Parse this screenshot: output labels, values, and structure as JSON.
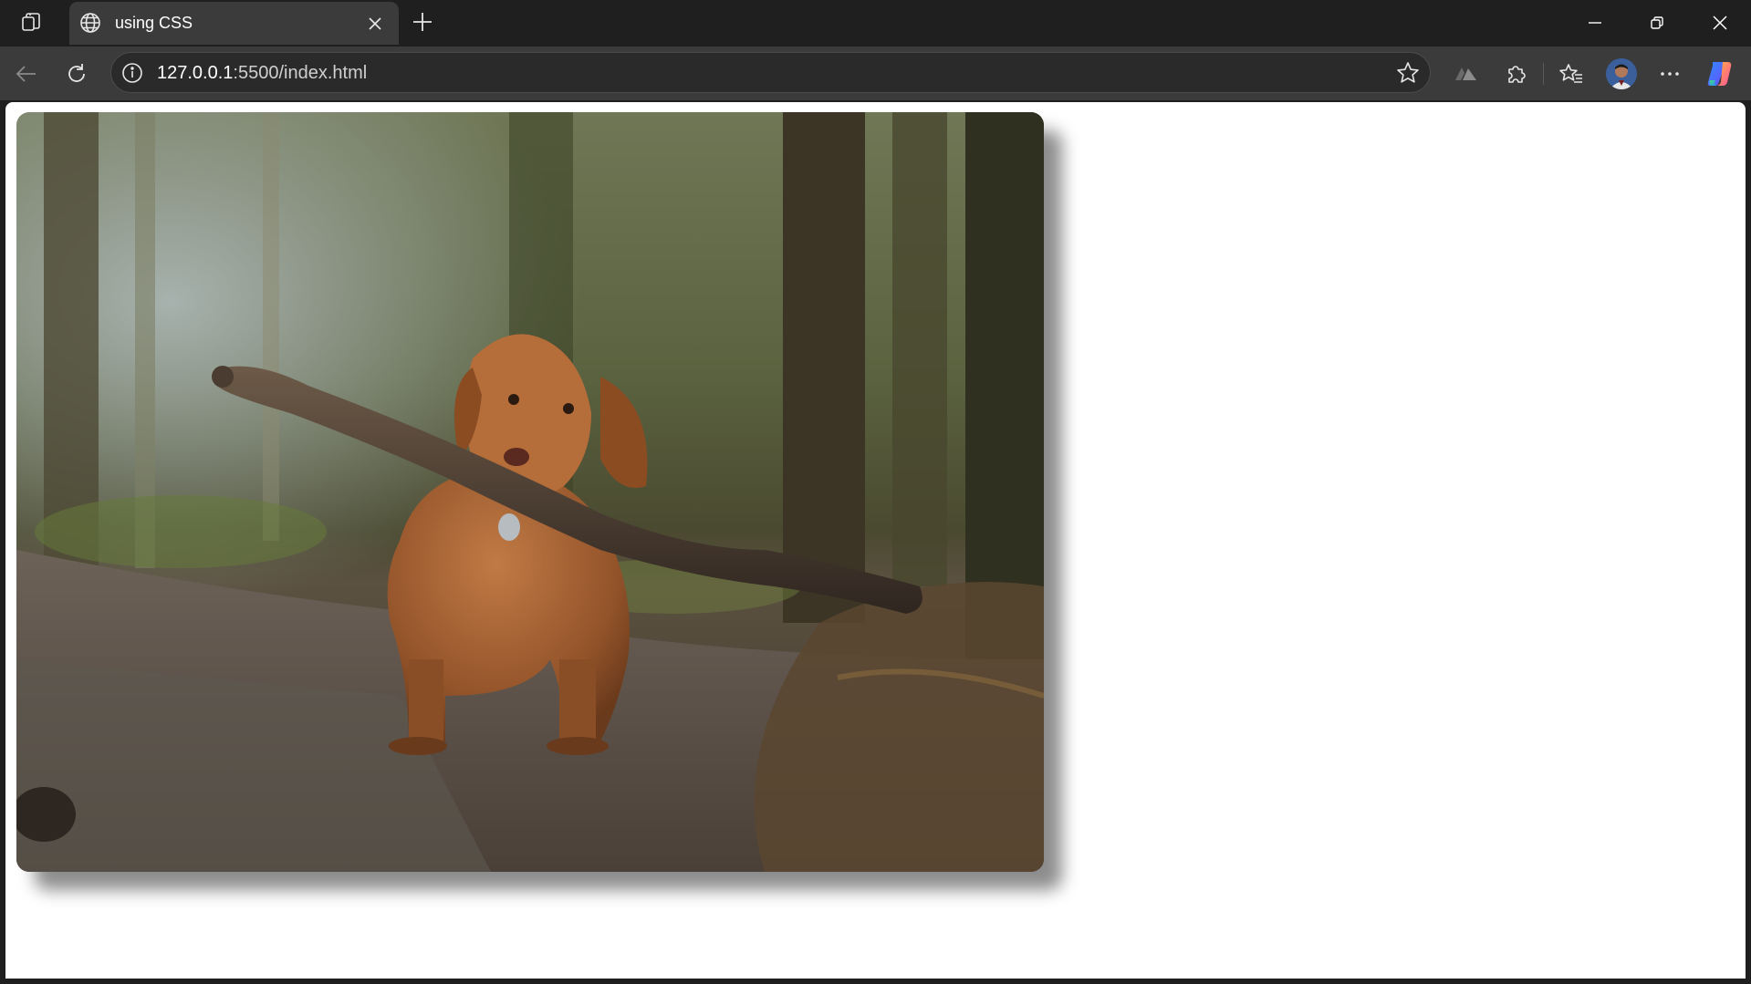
{
  "browser": {
    "tab": {
      "title": "using CSS",
      "favicon": "globe-icon"
    },
    "address_bar": {
      "url_host": "127.0.0.1",
      "url_rest": ":5500/index.html",
      "site_info_icon": "info-icon"
    },
    "toolbar_icons": [
      "back-arrow-icon",
      "reload-icon",
      "star-icon",
      "read-aloud-icon",
      "extensions-icon",
      "favorites-icon",
      "avatar",
      "more-icon",
      "copilot-icon"
    ],
    "window_controls": [
      "minimize-icon",
      "restore-icon",
      "close-icon"
    ]
  },
  "page": {
    "background": "#ffffff",
    "image": {
      "subject": "brown dog carrying a large stick on a muddy forest path",
      "shadow": true,
      "rounded_corners": true
    }
  },
  "colors": {
    "chrome_dark": "#1f1f1f",
    "chrome_tab": "#3b3b3b",
    "address_bg": "#2a2a2a"
  }
}
